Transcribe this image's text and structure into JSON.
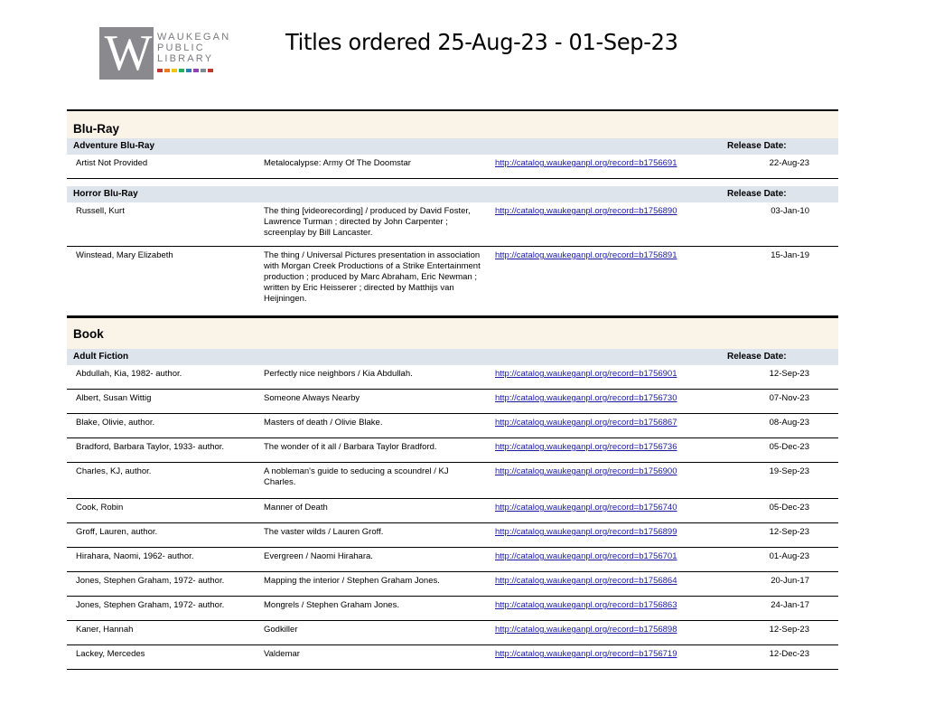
{
  "header": {
    "logo_lines": [
      "WAUKEGAN",
      "PUBLIC",
      "LIBRARY"
    ],
    "logo_colors": [
      "#c0392b",
      "#e67e22",
      "#f1c40f",
      "#27ae60",
      "#2980b9",
      "#8e44ad",
      "#7f8c8d",
      "#c0392b"
    ],
    "title": "Titles ordered 25-Aug-23 - 01-Sep-23"
  },
  "release_label": "Release Date:",
  "sections": [
    {
      "name": "Blu-Ray",
      "groups": [
        {
          "name": "Adventure Blu-Ray",
          "rows": [
            {
              "author": "Artist Not Provided",
              "title": "Metalocalypse: Army Of The Doomstar",
              "link": "http://catalog.waukeganpl.org/record=b1756691",
              "date": "22-Aug-23"
            }
          ]
        },
        {
          "name": "Horror Blu-Ray",
          "rows": [
            {
              "author": "Russell, Kurt",
              "title": "The thing [videorecording] / produced by David Foster, Lawrence Turman ; directed by John Carpenter ; screenplay by Bill Lancaster.",
              "link": "http://catalog.waukeganpl.org/record=b1756890",
              "date": "03-Jan-10"
            },
            {
              "author": "Winstead, Mary Elizabeth",
              "title": "The thing / Universal Pictures presentation in association with Morgan Creek Productions of a Strike Entertainment production ; produced by Marc Abraham, Eric Newman ; written by Eric Heisserer ; directed by Matthijs van Heijningen.",
              "link": "http://catalog.waukeganpl.org/record=b1756891",
              "date": "15-Jan-19"
            }
          ]
        }
      ]
    },
    {
      "name": "Book",
      "groups": [
        {
          "name": "Adult Fiction",
          "rows": [
            {
              "author": "Abdullah, Kia, 1982- author.",
              "title": "Perfectly nice neighbors / Kia Abdullah.",
              "link": "http://catalog.waukeganpl.org/record=b1756901",
              "date": "12-Sep-23"
            },
            {
              "author": "Albert, Susan Wittig",
              "title": "Someone Always Nearby",
              "link": "http://catalog.waukeganpl.org/record=b1756730",
              "date": "07-Nov-23"
            },
            {
              "author": "Blake, Olivie, author.",
              "title": "Masters of death / Olivie Blake.",
              "link": "http://catalog.waukeganpl.org/record=b1756867",
              "date": "08-Aug-23"
            },
            {
              "author": "Bradford, Barbara Taylor, 1933- author.",
              "title": "The wonder of it all / Barbara Taylor Bradford.",
              "link": "http://catalog.waukeganpl.org/record=b1756736",
              "date": "05-Dec-23"
            },
            {
              "author": "Charles, KJ, author.",
              "title": "A nobleman's guide to seducing a scoundrel / KJ Charles.",
              "link": "http://catalog.waukeganpl.org/record=b1756900",
              "date": "19-Sep-23"
            },
            {
              "author": "Cook, Robin",
              "title": "Manner of Death",
              "link": "http://catalog.waukeganpl.org/record=b1756740",
              "date": "05-Dec-23"
            },
            {
              "author": "Groff, Lauren, author.",
              "title": "The vaster wilds / Lauren Groff.",
              "link": "http://catalog.waukeganpl.org/record=b1756899",
              "date": "12-Sep-23"
            },
            {
              "author": "Hirahara, Naomi, 1962- author.",
              "title": "Evergreen / Naomi Hirahara.",
              "link": "http://catalog.waukeganpl.org/record=b1756701",
              "date": "01-Aug-23"
            },
            {
              "author": "Jones, Stephen Graham, 1972- author.",
              "title": "Mapping the interior / Stephen Graham Jones.",
              "link": "http://catalog.waukeganpl.org/record=b1756864",
              "date": "20-Jun-17"
            },
            {
              "author": "Jones, Stephen Graham, 1972- author.",
              "title": "Mongrels / Stephen Graham Jones.",
              "link": "http://catalog.waukeganpl.org/record=b1756863",
              "date": "24-Jan-17"
            },
            {
              "author": "Kaner, Hannah",
              "title": "Godkiller",
              "link": "http://catalog.waukeganpl.org/record=b1756898",
              "date": "12-Sep-23"
            },
            {
              "author": "Lackey, Mercedes",
              "title": "Valdemar",
              "link": "http://catalog.waukeganpl.org/record=b1756719",
              "date": "12-Dec-23"
            }
          ]
        }
      ]
    }
  ]
}
